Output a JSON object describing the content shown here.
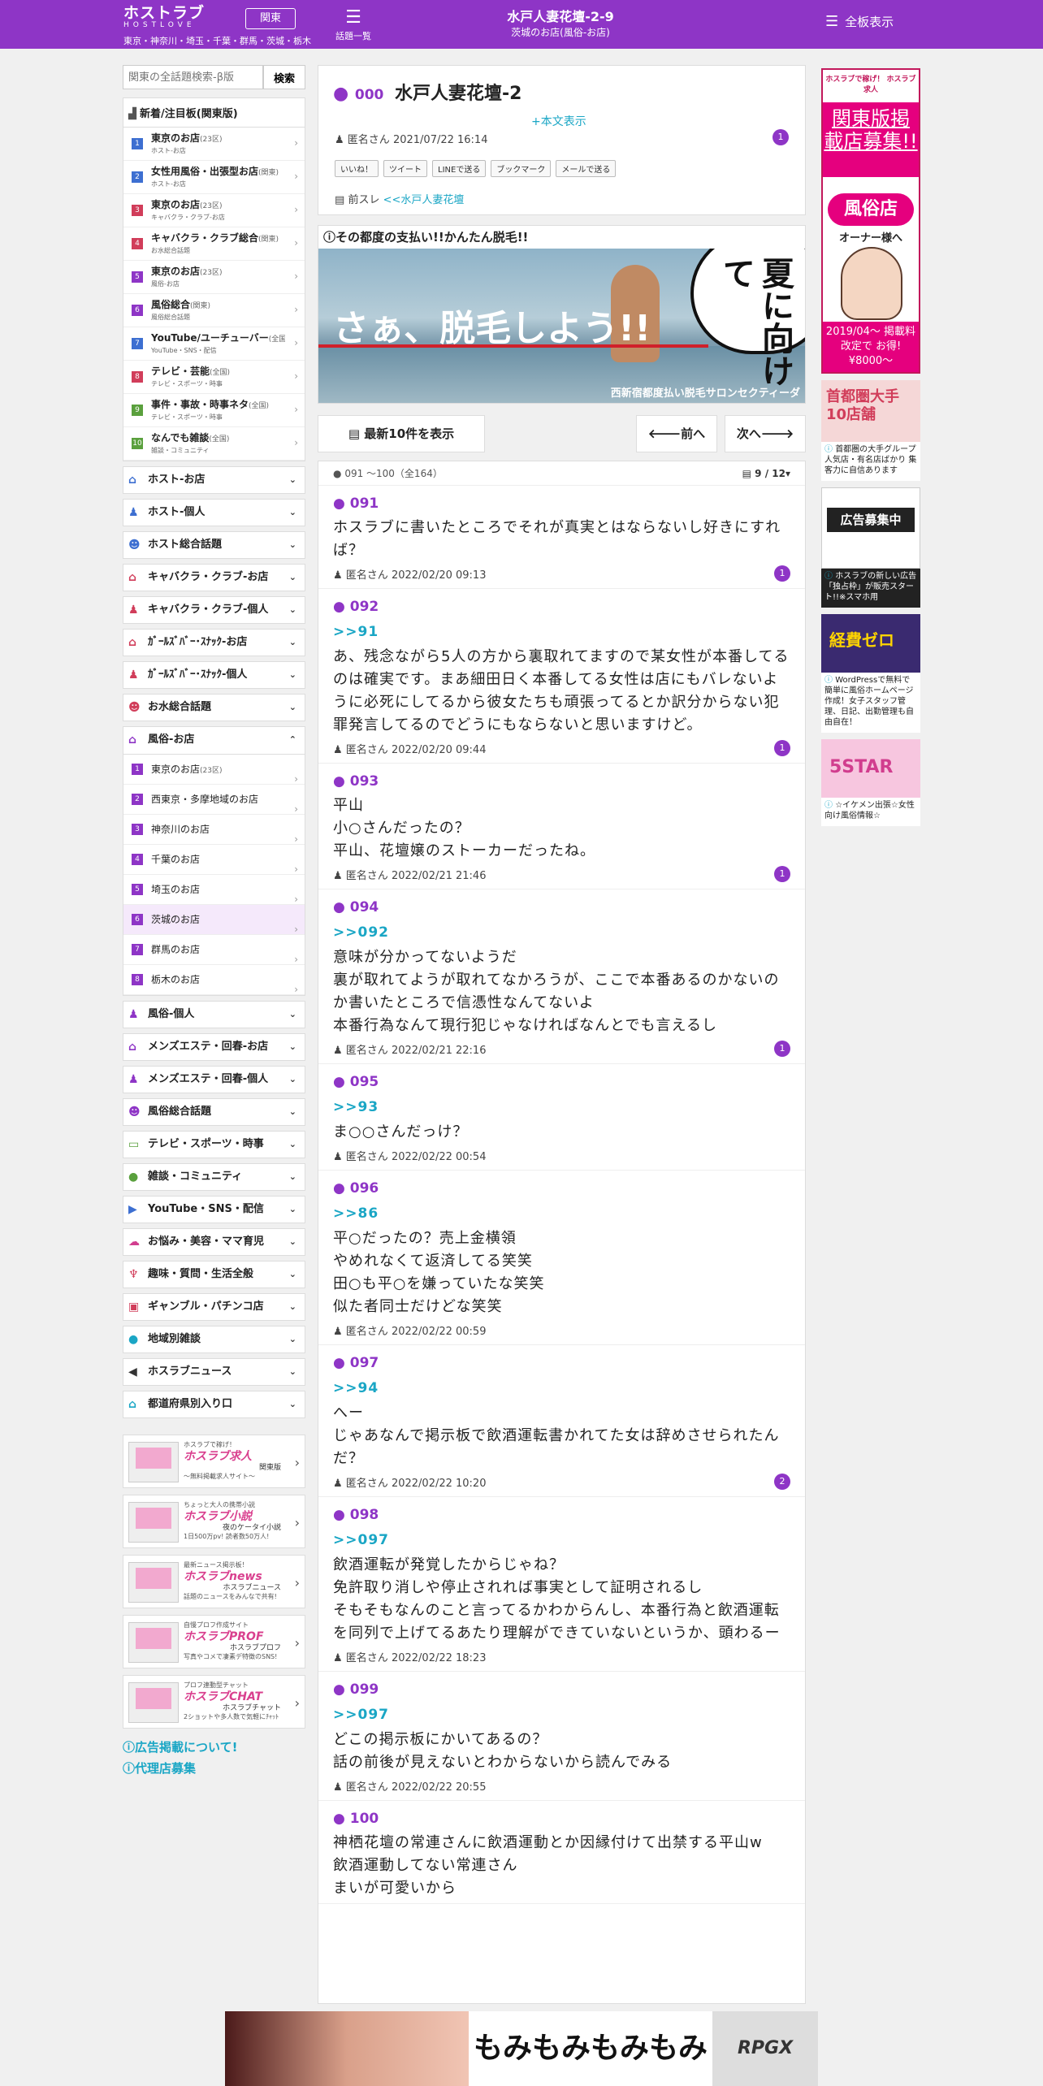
{
  "header": {
    "logo_main": "ホストラブ",
    "logo_sub": "HOSTLOVE",
    "logo_region_text": "東京・神奈川・埼玉・千葉・群馬・茨城・栃木",
    "region_button": "関東",
    "topics_label": "話題一覧",
    "title": "水戸人妻花壇-2-9",
    "subtitle": "茨城のお店(風俗-お店)",
    "all_boards_label": "全板表示"
  },
  "search": {
    "placeholder": "関東の全話題検索-β版",
    "button": "検索"
  },
  "ranking": {
    "heading": "新着/注目板(関東版)",
    "items": [
      {
        "n": "1",
        "name": "東京のお店",
        "area": "(23区)",
        "sub": "ホスト-お店",
        "color": "#3d6fd1"
      },
      {
        "n": "2",
        "name": "女性用風俗・出張型お店",
        "area": "(関東)",
        "sub": "ホスト-お店",
        "color": "#3d6fd1"
      },
      {
        "n": "3",
        "name": "東京のお店",
        "area": "(23区)",
        "sub": "キャバクラ・クラブ-お店",
        "color": "#d13d5a"
      },
      {
        "n": "4",
        "name": "キャバクラ・クラブ総合",
        "area": "(関東)",
        "sub": "お水総合話題",
        "color": "#d13d5a"
      },
      {
        "n": "5",
        "name": "東京のお店",
        "area": "(23区)",
        "sub": "風俗-お店",
        "color": "#8e35c6"
      },
      {
        "n": "6",
        "name": "風俗総合",
        "area": "(関東)",
        "sub": "風俗総合話題",
        "color": "#8e35c6"
      },
      {
        "n": "7",
        "name": "YouTube/ユーチューバー",
        "area": "(全国)",
        "sub": "YouTube・SNS・配信",
        "color": "#3d6fd1"
      },
      {
        "n": "8",
        "name": "テレビ・芸能",
        "area": "(全国)",
        "sub": "テレビ・スポーツ・時事",
        "color": "#d13d5a"
      },
      {
        "n": "9",
        "name": "事件・事故・時事ネタ",
        "area": "(全国)",
        "sub": "テレビ・スポーツ・時事",
        "color": "#5aa03d"
      },
      {
        "n": "10",
        "name": "なんでも雑談",
        "area": "(全国)",
        "sub": "雑談・コミュニティ",
        "color": "#5aa03d"
      }
    ]
  },
  "categories_top": [
    {
      "label": "ホスト-お店",
      "icon": "⌂",
      "color": "#3d6fd1"
    },
    {
      "label": "ホスト-個人",
      "icon": "♟",
      "color": "#3d6fd1"
    },
    {
      "label": "ホスト総合話題",
      "icon": "☻",
      "color": "#3d6fd1"
    },
    {
      "label": "キャバクラ・クラブ-お店",
      "icon": "⌂",
      "color": "#d13d5a"
    },
    {
      "label": "キャバクラ・クラブ-個人",
      "icon": "♟",
      "color": "#d13d5a"
    },
    {
      "label": "ｶﾞｰﾙｽﾞﾊﾞｰ･ｽﾅｯｸ-お店",
      "icon": "⌂",
      "color": "#d13d5a"
    },
    {
      "label": "ｶﾞｰﾙｽﾞﾊﾞｰ･ｽﾅｯｸ-個人",
      "icon": "♟",
      "color": "#d13d5a"
    },
    {
      "label": "お水総合話題",
      "icon": "☻",
      "color": "#d13d5a"
    }
  ],
  "fuzoku": {
    "label": "風俗-お店",
    "items": [
      {
        "n": "1",
        "label": "東京のお店",
        "area": "(23区)"
      },
      {
        "n": "2",
        "label": "西東京・多摩地域のお店",
        "area": ""
      },
      {
        "n": "3",
        "label": "神奈川のお店",
        "area": ""
      },
      {
        "n": "4",
        "label": "千葉のお店",
        "area": ""
      },
      {
        "n": "5",
        "label": "埼玉のお店",
        "area": ""
      },
      {
        "n": "6",
        "label": "茨城のお店",
        "area": ""
      },
      {
        "n": "7",
        "label": "群馬のお店",
        "area": ""
      },
      {
        "n": "8",
        "label": "栃木のお店",
        "area": ""
      }
    ]
  },
  "categories_bottom": [
    {
      "label": "風俗-個人",
      "icon": "♟",
      "color": "#8e35c6"
    },
    {
      "label": "メンズエステ・回春-お店",
      "icon": "⌂",
      "color": "#8e35c6"
    },
    {
      "label": "メンズエステ・回春-個人",
      "icon": "♟",
      "color": "#8e35c6"
    },
    {
      "label": "風俗総合話題",
      "icon": "☻",
      "color": "#8e35c6"
    },
    {
      "label": "テレビ・スポーツ・時事",
      "icon": "▭",
      "color": "#5aa03d"
    },
    {
      "label": "雑談・コミュニティ",
      "icon": "●",
      "color": "#5aa03d"
    },
    {
      "label": "YouTube・SNS・配信",
      "icon": "▶",
      "color": "#3d6fd1"
    },
    {
      "label": "お悩み・美容・ママ育児",
      "icon": "☁",
      "color": "#d13d8e"
    },
    {
      "label": "趣味・質問・生活全般",
      "icon": "♆",
      "color": "#d13d5a"
    },
    {
      "label": "ギャンブル・パチンコ店",
      "icon": "▣",
      "color": "#d13d5a"
    },
    {
      "label": "地域別雑談",
      "icon": "●",
      "color": "#1aa6c5"
    },
    {
      "label": "ホスラブニュース",
      "icon": "◀",
      "color": "#333333"
    },
    {
      "label": "都道府県別入り口",
      "icon": "⌂",
      "color": "#1aa6c5"
    }
  ],
  "services": [
    {
      "t1": "ホスラブで稼げ！",
      "t2": "ホスラブ求人",
      "t3": "関東版",
      "t4": "〜無料掲載求人サイト〜"
    },
    {
      "t1": "ちょっと大人の携帯小説",
      "t2": "ホスラブ小説",
      "t3": "夜のケータイ小説",
      "t4": "1日500万pv! 読者数50万人!"
    },
    {
      "t1": "最新ニュース掲示板！",
      "t2": "ホスラブnews",
      "t3": "ホスラブニュース",
      "t4": "話題のニュースをみんなで共有!"
    },
    {
      "t1": "自慢プロフ作成サイト",
      "t2": "ホスラブPROF",
      "t3": "ホスラブプロフ",
      "t4": "写真やコメで凄素デ特徴のSNS!"
    },
    {
      "t1": "プロフ連動型チャット",
      "t2": "ホスラブCHAT",
      "t3": "ホスラブチャット",
      "t4": "2ショットや多人数で気軽にﾁｬｯﾄ"
    }
  ],
  "side_links": [
    "広告掲載について!",
    "代理店募集"
  ],
  "thread": {
    "num": "000",
    "title": "水戸人妻花壇-2",
    "expand": "+本文表示",
    "author": "匿名さん",
    "date": "2021/07/22 16:14",
    "badge": "1",
    "shares": [
      "いいね！",
      "ツイート",
      "LINEで送る",
      "ブックマーク",
      "メールで送る"
    ],
    "prev_label": "前スレ",
    "prev_link": "<<水戸人妻花壇"
  },
  "ad1": {
    "caption": "その都度の支払い!!かんたん脱毛!!",
    "big": "さぁ、脱毛しよう!!",
    "bubble": "夏に向けて",
    "foot": "西新宿都度払い脱毛サロンセクティーダ"
  },
  "pager": {
    "latest": "最新10件を表示",
    "prev": "前へ",
    "next": "次へ"
  },
  "posts_header": {
    "range": "091 ～100（全164）",
    "page": "9 / 12"
  },
  "posts": [
    {
      "num": "091",
      "ref": "",
      "body": "ホスラブに書いたところでそれが真実とはならないし好きにすれば？",
      "author": "匿名さん",
      "date": "2022/02/20 09:13",
      "badge": "1"
    },
    {
      "num": "092",
      "ref": ">>91",
      "body": "あ、残念ながら5人の方から裏取れてますので某女性が本番してるのは確実です。まあ細田日く本番してる女性は店にもバレないように必死にしてるから彼女たちも頑張ってるとか訳分からない犯罪発言してるのでどうにもならないと思いますけど。",
      "author": "匿名さん",
      "date": "2022/02/20 09:44",
      "badge": "1"
    },
    {
      "num": "093",
      "ref": "",
      "body": "平山\n小○さんだったの？\n平山、花壇嬢のストーカーだったね。",
      "author": "匿名さん",
      "date": "2022/02/21 21:46",
      "badge": "1"
    },
    {
      "num": "094",
      "ref": ">>092",
      "body": "意味が分かってないようだ\n裏が取れてようが取れてなかろうが、ここで本番あるのかないのか書いたところで信憑性なんてないよ\n本番行為なんて現行犯じゃなければなんとでも言えるし",
      "author": "匿名さん",
      "date": "2022/02/21 22:16",
      "badge": "1"
    },
    {
      "num": "095",
      "ref": ">>93",
      "body": "ま○○さんだっけ？",
      "author": "匿名さん",
      "date": "2022/02/22 00:54",
      "badge": ""
    },
    {
      "num": "096",
      "ref": ">>86",
      "body": "平○だったの？売上金横領\nやめれなくて返済してる笑笑\n田○も平○を嫌っていたな笑笑\n似た者同士だけどな笑笑",
      "author": "匿名さん",
      "date": "2022/02/22 00:59",
      "badge": ""
    },
    {
      "num": "097",
      "ref": ">>94",
      "body": "へー\nじゃあなんで掲示板で飲酒運転書かれてた女は辞めさせられたんだ？",
      "author": "匿名さん",
      "date": "2022/02/22 10:20",
      "badge": "2"
    },
    {
      "num": "098",
      "ref": ">>097",
      "body": "飲酒運転が発覚したからじゃね？\n免許取り消しや停止されれば事実として証明されるし\nそもそもなんのこと言ってるかわからんし、本番行為と飲酒運転を同列で上げてるあたり理解ができていないというか、頭わるー",
      "author": "匿名さん",
      "date": "2022/02/22 18:23",
      "badge": ""
    },
    {
      "num": "099",
      "ref": ">>097",
      "body": "どこの掲示板にかいてあるの？\n話の前後が見えないとわからないから読んでみる",
      "author": "匿名さん",
      "date": "2022/02/22 20:55",
      "badge": ""
    },
    {
      "num": "100",
      "ref": "",
      "body": "神栖花壇の常連さんに飲酒運動とか因縁付けて出禁する平山w\n飲酒運動してない常連さん\nまいが可愛いから",
      "author": "",
      "date": "",
      "badge": ""
    }
  ],
  "right_ads": {
    "ad1": {
      "top": "ホスラブで稼げ！ ホスラブ求人",
      "main": "関東版掲載店募集!!",
      "fuzoku": "風俗店",
      "owner": "オーナー様へ",
      "bottom": "2019/04〜 掲載料改定で お得!¥8000〜"
    },
    "ad2": {
      "img_text": "首都圏大手10店舗",
      "caption": "首都圏の大手グループ 人気店・有名店ばかり 集客力に自信あります"
    },
    "ad3": {
      "img_text": "広告募集中",
      "caption": "ホスラブの新しい広告「独占枠」が販売スタート!!※スマホ用"
    },
    "ad4": {
      "img_text": "経費ゼロ",
      "caption": "WordPressで無料で簡単に風俗ホームページ作成！女子スタッフ管理、日記、出勤管理も自由自在！"
    },
    "ad5": {
      "img_text": "5STAR",
      "caption": "☆イケメン出張☆女性向け風俗情報☆"
    }
  },
  "bottom_ad": {
    "text": "もみもみもみもみ",
    "logo": "RPGX"
  }
}
